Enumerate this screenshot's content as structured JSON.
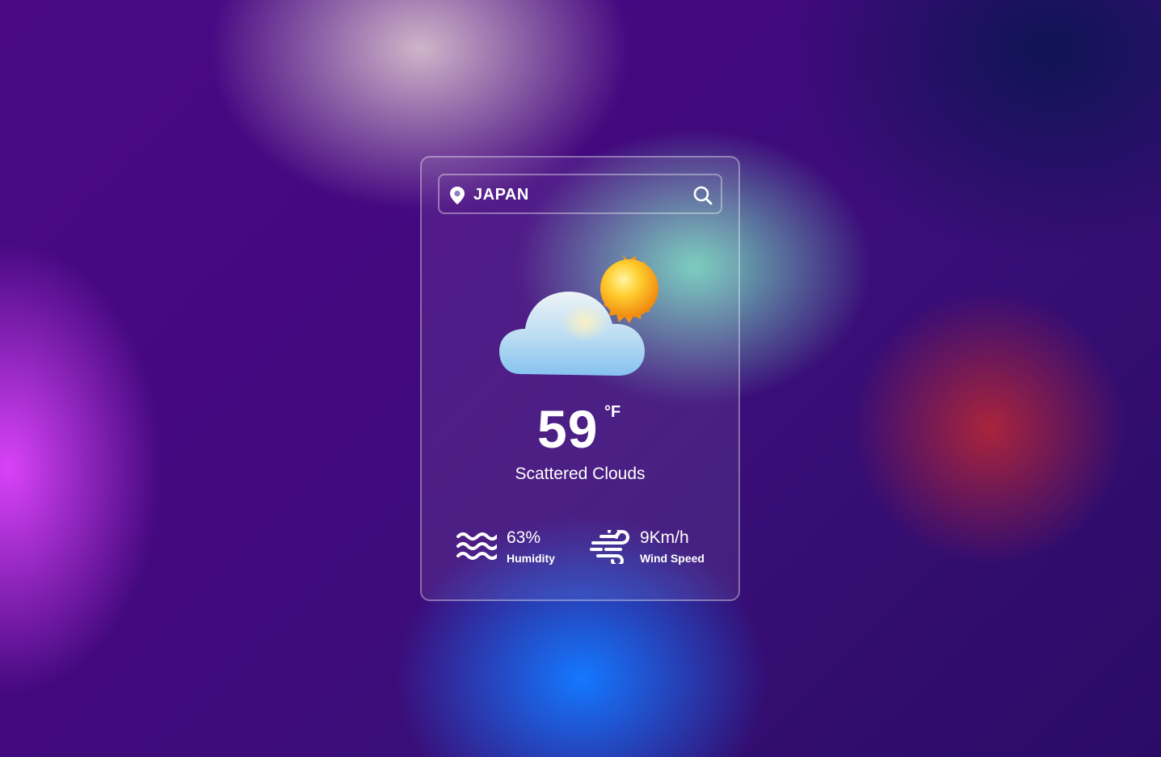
{
  "search": {
    "value": "JAPAN",
    "pin_icon": "map-pin-icon",
    "search_icon": "search-icon"
  },
  "weather": {
    "icon": "partly-cloudy-icon",
    "temperature": "59",
    "unit": "°F",
    "description": "Scattered Clouds"
  },
  "stats": {
    "humidity": {
      "icon": "water-waves-icon",
      "value": "63%",
      "label": "Humidity"
    },
    "wind": {
      "icon": "wind-icon",
      "value": "9Km/h",
      "label": "Wind Speed"
    }
  },
  "colors": {
    "text": "#ffffff",
    "sun": "#f7a81b",
    "cloud": "#9fd0f5"
  }
}
